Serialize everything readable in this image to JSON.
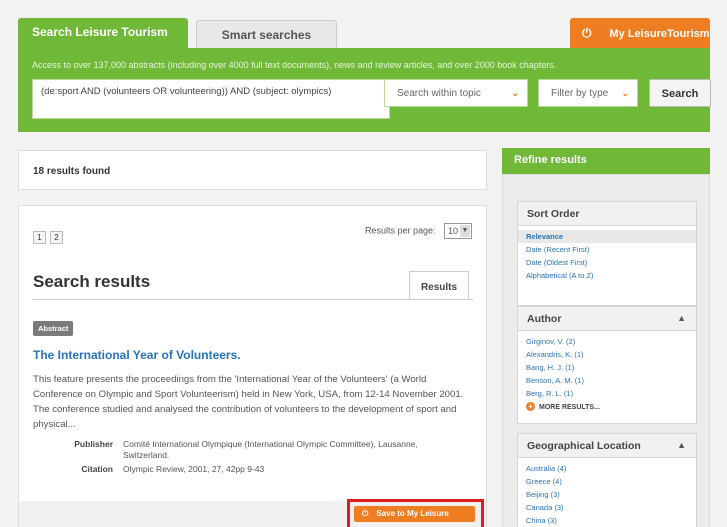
{
  "tabs": {
    "search": "Search Leisure Tourism",
    "smart": "Smart searches",
    "my": "My LeisureTourism"
  },
  "band": {
    "note": "Access to over 137,000 abstracts (including over 4000 full text documents), news and review articles, and over 2000 book chapters.",
    "query": "(de:sport AND (volunteers OR volunteering)) AND (subject: olympics)",
    "topic_select": "Search within topic",
    "type_select": "Filter by type",
    "search_button": "Search"
  },
  "results": {
    "count_text": "18 results found",
    "pages": [
      "1",
      "2"
    ],
    "per_page_label": "Results per page:",
    "per_page_value": "10",
    "heading": "Search results",
    "tab": "Results"
  },
  "result": {
    "badge": "Abstract",
    "title": "The International Year of Volunteers.",
    "description": "This feature presents the proceedings from the 'International Year of the Volunteers' (a World Conference on Olympic and Sport Volunteerism) held in New York, USA, from 12-14 November 2001. The conference studied and analysed the contribution of volunteers to the development of sport and physical...",
    "publisher_label": "Publisher",
    "publisher": "Comité International Olympique (International Olympic Committee), Lausanne, Switzerland.",
    "citation_label": "Citation",
    "citation": "Olympic Review, 2001, 27, 42pp 9-43",
    "save_button": "Save to My Leisure"
  },
  "refine": {
    "heading": "Refine results",
    "sort": {
      "title": "Sort Order",
      "items": [
        "Relevance",
        "Date (Recent First)",
        "Date (Oldest First)",
        "Alphabetical (A to Z)"
      ]
    },
    "author": {
      "title": "Author",
      "items": [
        "Girginov, V. (2)",
        "Alexandris, K. (1)",
        "Bang, H. J. (1)",
        "Benson, A. M. (1)",
        "Berg, R. L. (1)"
      ],
      "more": "MORE RESULTS..."
    },
    "geo": {
      "title": "Geographical Location",
      "items": [
        "Australia (4)",
        "Greece (4)",
        "Beijing (3)",
        "Canada (3)",
        "China (3)"
      ]
    }
  },
  "colors": {
    "green": "#6fb838",
    "orange": "#ef7d22",
    "link": "#2a73b8",
    "highlight": "#e01b22"
  }
}
